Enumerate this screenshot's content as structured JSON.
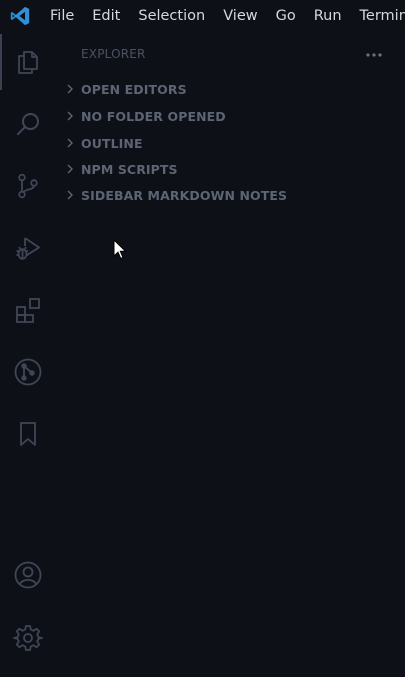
{
  "menu": {
    "items": [
      "File",
      "Edit",
      "Selection",
      "View",
      "Go",
      "Run",
      "Terminal"
    ]
  },
  "activity_bar": {
    "items": [
      {
        "name": "explorer",
        "icon": "files-icon",
        "active": true
      },
      {
        "name": "search",
        "icon": "search-icon",
        "active": false
      },
      {
        "name": "source-control",
        "icon": "source-control-icon",
        "active": false
      },
      {
        "name": "run-and-debug",
        "icon": "run-debug-icon",
        "active": false
      },
      {
        "name": "extensions",
        "icon": "extensions-icon",
        "active": false
      },
      {
        "name": "git-graph",
        "icon": "git-graph-icon",
        "active": false
      },
      {
        "name": "bookmarks",
        "icon": "bookmark-icon",
        "active": false
      }
    ],
    "bottom_items": [
      {
        "name": "accounts",
        "icon": "account-icon"
      },
      {
        "name": "manage",
        "icon": "gear-icon"
      }
    ]
  },
  "sidebar": {
    "title": "EXPLORER",
    "more_actions_icon": "ellipsis-icon",
    "sections": [
      {
        "label": "OPEN EDITORS",
        "expanded": false
      },
      {
        "label": "NO FOLDER OPENED",
        "expanded": false
      },
      {
        "label": "OUTLINE",
        "expanded": false
      },
      {
        "label": "NPM SCRIPTS",
        "expanded": false
      },
      {
        "label": "SIDEBAR MARKDOWN NOTES",
        "expanded": false
      }
    ]
  },
  "colors": {
    "background": "#0d1017",
    "menu_text": "#d6d8dc",
    "icon": "#3f4655",
    "section_text": "#5d6473",
    "title_text": "#4b5262",
    "brand_blue": "#2f8fd8"
  }
}
